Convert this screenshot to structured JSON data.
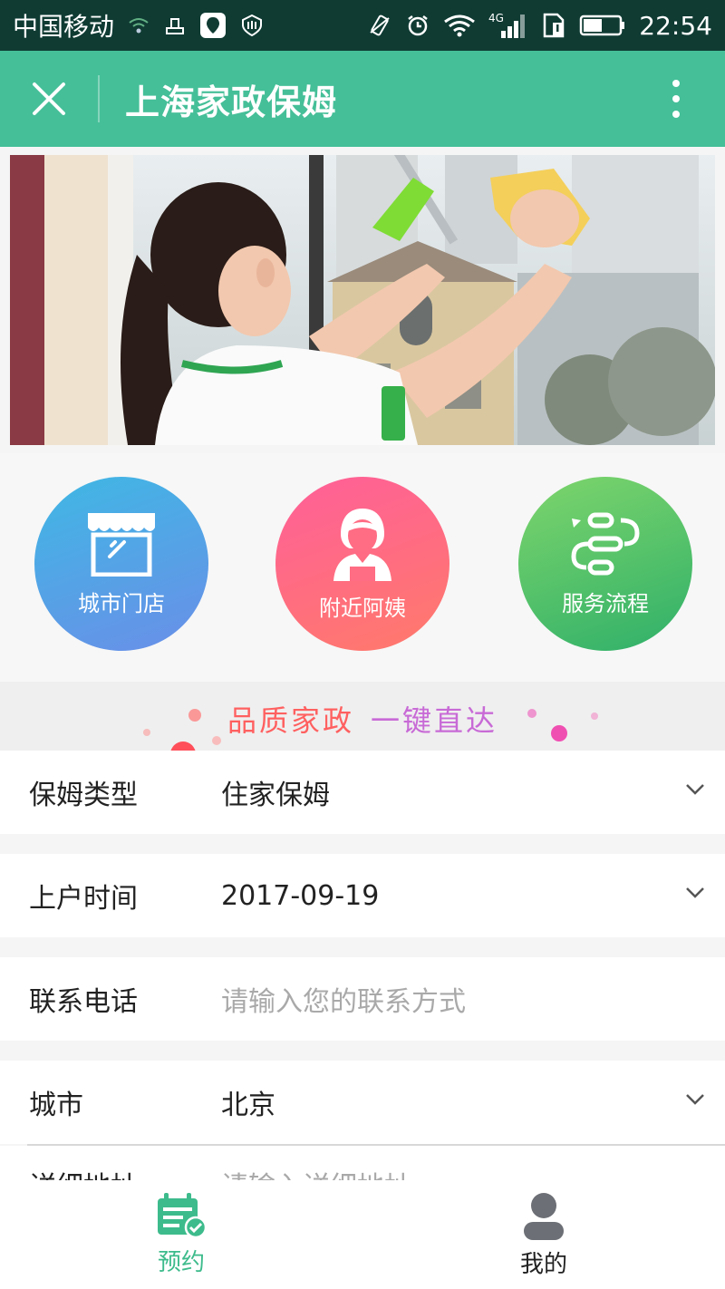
{
  "status_bar": {
    "carrier": "中国移动",
    "network": "4G",
    "time": "22:54"
  },
  "header": {
    "title": "上海家政保姆"
  },
  "quick_links": [
    {
      "label": "城市门店",
      "icon": "store-icon"
    },
    {
      "label": "附近阿姨",
      "icon": "nanny-icon"
    },
    {
      "label": "服务流程",
      "icon": "process-icon"
    }
  ],
  "slogan": {
    "part1": "品质家政",
    "part2": "一键直达"
  },
  "form": {
    "nanny_type": {
      "label": "保姆类型",
      "value": "住家保姆"
    },
    "start_date": {
      "label": "上户时间",
      "value": "2017-09-19"
    },
    "phone": {
      "label": "联系电话",
      "placeholder": "请输入您的联系方式"
    },
    "city": {
      "label": "城市",
      "value": "北京"
    },
    "address": {
      "label": "详细地址",
      "placeholder": "请输入详细地址"
    }
  },
  "tabbar": {
    "book": "预约",
    "mine": "我的"
  },
  "colors": {
    "header_green": "#45bf98",
    "tab_active": "#3dbb8c",
    "slogan_red": "#ff6060",
    "slogan_purple": "#c86ad6"
  }
}
